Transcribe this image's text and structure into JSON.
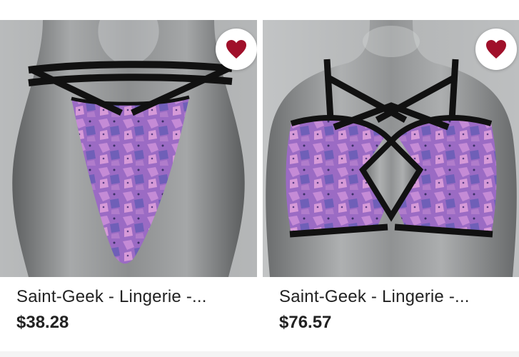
{
  "colors": {
    "heart": "#a0102a",
    "fabric": "#8a5fb5",
    "strap": "#111111",
    "mannequin": "#9a9c9d"
  },
  "products": [
    {
      "title": "Saint-Geek - Lingerie -...",
      "price": "$38.28",
      "image_subject": "purple dice-print thong with black cross straps on mannequin",
      "favorite_icon": "heart-icon",
      "favorited": true
    },
    {
      "title": "Saint-Geek - Lingerie -...",
      "price": "$76.57",
      "image_subject": "purple dice-print bralette with black cage straps on mannequin",
      "favorite_icon": "heart-icon",
      "favorited": true
    }
  ]
}
